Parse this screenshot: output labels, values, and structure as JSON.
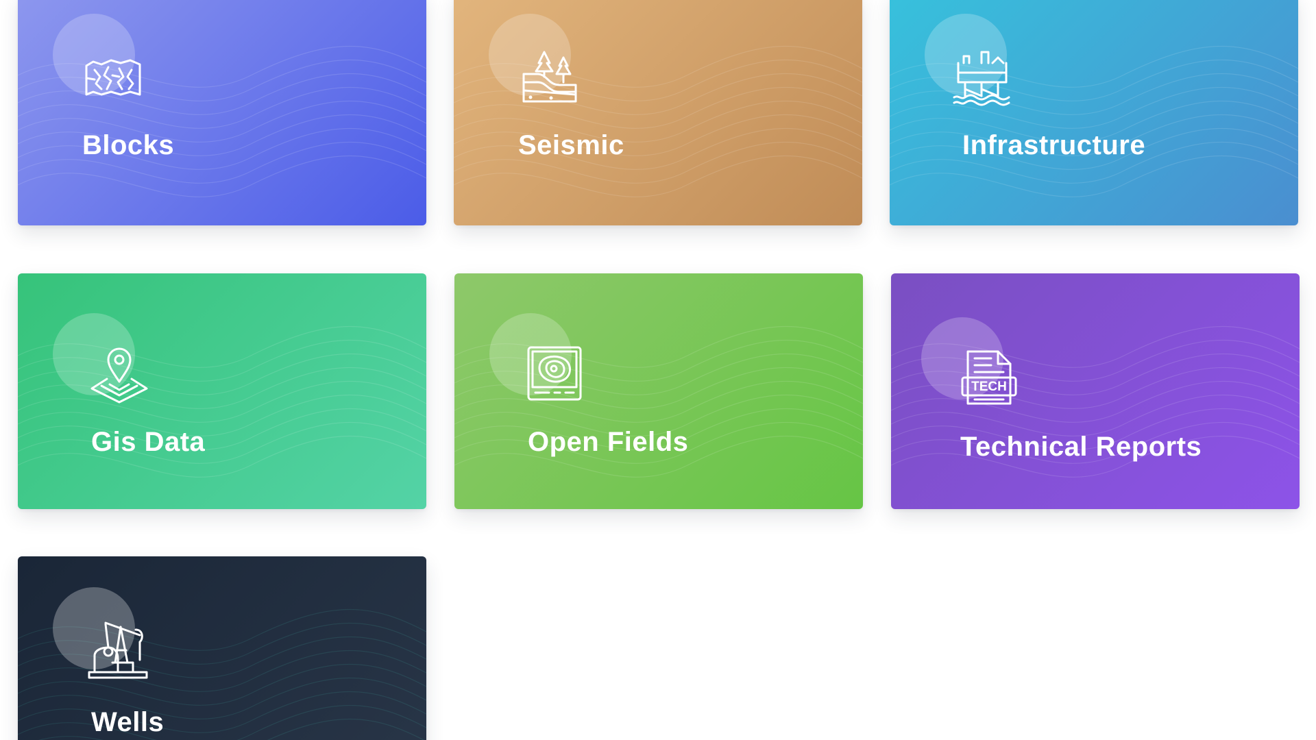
{
  "cards": [
    {
      "label": "Blocks",
      "icon": "blocks-map-icon",
      "gradient": [
        "#8d97ee",
        "#4b5ce8"
      ]
    },
    {
      "label": "Seismic",
      "icon": "seismic-layers-icon",
      "gradient": [
        "#e2b57d",
        "#c08c57"
      ]
    },
    {
      "label": "Infrastructure",
      "icon": "offshore-platform-icon",
      "gradient": [
        "#37c1dc",
        "#4a8ed0"
      ]
    },
    {
      "label": "Gis Data",
      "icon": "map-pin-icon",
      "gradient": [
        "#36c37a",
        "#54d3a6"
      ]
    },
    {
      "label": "Open Fields",
      "icon": "contour-map-icon",
      "gradient": [
        "#8ec86a",
        "#66c545"
      ]
    },
    {
      "label": "Technical Reports",
      "icon": "tech-document-icon",
      "gradient": [
        "#7a4fc2",
        "#8d53e8"
      ]
    },
    {
      "label": "Wells",
      "icon": "oil-pumpjack-icon",
      "gradient": [
        "#1a2637",
        "#283547"
      ]
    }
  ]
}
